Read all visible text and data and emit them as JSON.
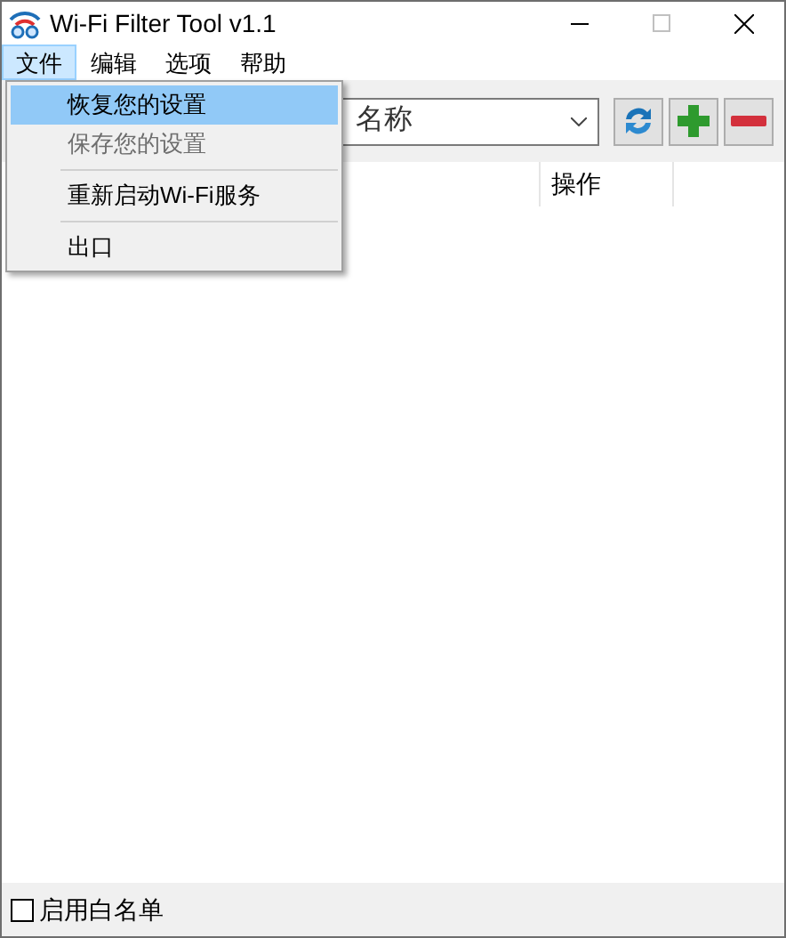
{
  "window": {
    "title": "Wi-Fi Filter Tool v1.1"
  },
  "menu_bar": [
    {
      "label": "文件",
      "selected": true
    },
    {
      "label": "编辑",
      "selected": false
    },
    {
      "label": "选项",
      "selected": false
    },
    {
      "label": "帮助",
      "selected": false
    }
  ],
  "open_menu": {
    "items": [
      {
        "kind": "item",
        "label": "恢复您的设置",
        "selected": true,
        "disabled": false
      },
      {
        "kind": "item",
        "label": "保存您的设置",
        "selected": false,
        "disabled": true
      },
      {
        "kind": "separator"
      },
      {
        "kind": "item",
        "label": "重新启动Wi-Fi服务",
        "selected": false,
        "disabled": false
      },
      {
        "kind": "separator"
      },
      {
        "kind": "item",
        "label": "出口",
        "selected": false,
        "disabled": false
      }
    ]
  },
  "toolbar": {
    "network_select": {
      "value": "名称"
    }
  },
  "table": {
    "columns": [
      "操作"
    ]
  },
  "status_bar": {
    "whitelist_checkbox": {
      "label": "启用白名单",
      "checked": false
    }
  }
}
